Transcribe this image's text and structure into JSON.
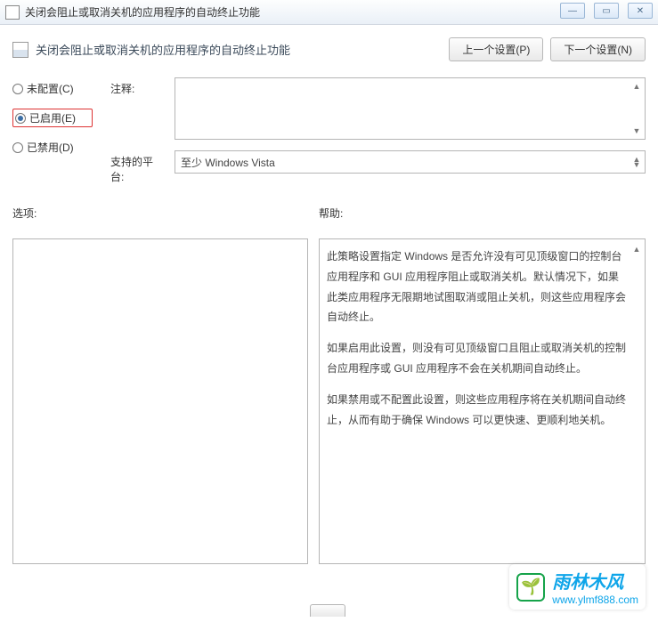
{
  "window": {
    "title": "关闭会阻止或取消关机的应用程序的自动终止功能"
  },
  "header": {
    "title": "关闭会阻止或取消关机的应用程序的自动终止功能",
    "prev_button": "上一个设置(P)",
    "next_button": "下一个设置(N)"
  },
  "radios": {
    "not_configured": "未配置(C)",
    "enabled": "已启用(E)",
    "disabled": "已禁用(D)",
    "selected": "enabled"
  },
  "fields": {
    "comment_label": "注释:",
    "comment_value": "",
    "platform_label": "支持的平台:",
    "platform_value": "至少 Windows Vista"
  },
  "lower": {
    "options_label": "选项:",
    "help_label": "帮助:",
    "help_paragraphs": [
      "此策略设置指定 Windows 是否允许没有可见顶级窗口的控制台应用程序和 GUI 应用程序阻止或取消关机。默认情况下，如果此类应用程序无限期地试图取消或阻止关机，则这些应用程序会自动终止。",
      "如果启用此设置，则没有可见顶级窗口且阻止或取消关机的控制台应用程序或 GUI 应用程序不会在关机期间自动终止。",
      "如果禁用或不配置此设置，则这些应用程序将在关机期间自动终止，从而有助于确保 Windows 可以更快速、更顺利地关机。"
    ]
  },
  "watermark": {
    "brand": "雨林木风",
    "url": "www.ylmf888.com"
  }
}
